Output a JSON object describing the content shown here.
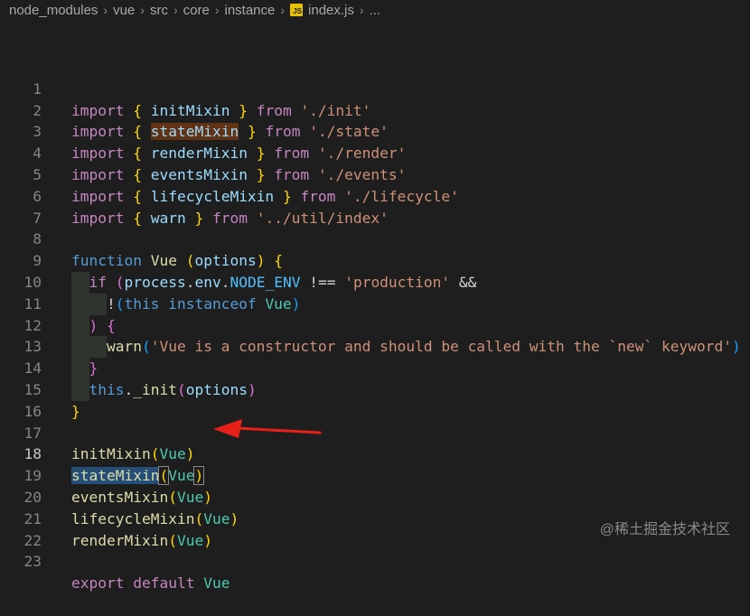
{
  "breadcrumb": {
    "items": [
      "node_modules",
      "vue",
      "src",
      "core",
      "instance"
    ],
    "file_icon": "JS",
    "file_name": "index.js",
    "trailing": "..."
  },
  "editor": {
    "active_line": 18,
    "line_numbers": [
      "1",
      "2",
      "3",
      "4",
      "5",
      "6",
      "7",
      "8",
      "9",
      "10",
      "11",
      "12",
      "13",
      "14",
      "15",
      "16",
      "17",
      "18",
      "19",
      "20",
      "21",
      "22",
      "23"
    ],
    "tokens": {
      "import": "import",
      "from": "from",
      "lb": "{",
      "rb": "}",
      "initMixin": "initMixin",
      "stateMixin": "stateMixin",
      "renderMixin": "renderMixin",
      "eventsMixin": "eventsMixin",
      "lifecycleMixin": "lifecycleMixin",
      "warn": "warn",
      "path_init": "'./init'",
      "path_state": "'./state'",
      "path_render": "'./render'",
      "path_events": "'./events'",
      "path_lifecycle": "'./lifecycle'",
      "path_util": "'../util/index'",
      "function": "function",
      "Vue": "Vue",
      "options": "options",
      "if": "if",
      "process": "process",
      "env": "env",
      "NODE_ENV": "NODE_ENV",
      "neq": "!==",
      "production": "'production'",
      "and": "&&",
      "not": "!",
      "this": "this",
      "instanceof": "instanceof",
      "warn_msg": "'Vue is a constructor and should be called with the `new` keyword'",
      "init": "_init",
      "export": "export",
      "default": "default"
    }
  },
  "watermark": "@稀土掘金技术社区"
}
